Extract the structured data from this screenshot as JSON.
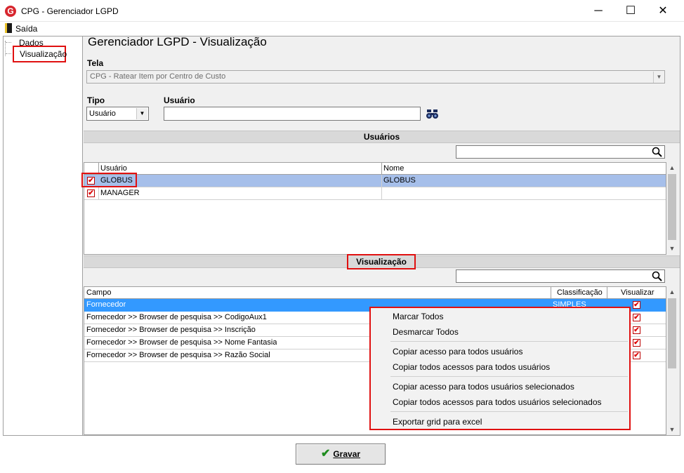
{
  "window": {
    "title": "CPG - Gerenciador LGPD",
    "logo_letter": "G",
    "minimize_glyph": "─",
    "maximize_glyph": "☐",
    "close_glyph": "✕"
  },
  "menu": {
    "exit_label": "Saída"
  },
  "tree": {
    "items": [
      "Dados",
      "Visualização"
    ],
    "selected": "Visualização"
  },
  "page_title": "Gerenciador LGPD - Visualização",
  "tela": {
    "label": "Tela",
    "value": "CPG - Ratear Item por Centro de Custo"
  },
  "tipo": {
    "label": "Tipo",
    "value": "Usuário"
  },
  "usuario": {
    "label": "Usuário",
    "value": ""
  },
  "users_section": {
    "title": "Usuários",
    "search_value": "",
    "columns": [
      "Usuário",
      "Nome"
    ],
    "rows": [
      {
        "checked": true,
        "usuario": "GLOBUS",
        "nome": "GLOBUS",
        "selected": true
      },
      {
        "checked": true,
        "usuario": "MANAGER",
        "nome": "",
        "selected": false
      }
    ]
  },
  "view_section": {
    "title": "Visualização",
    "search_value": "",
    "columns": [
      "Campo",
      "Classificação",
      "Visualizar"
    ],
    "rows": [
      {
        "campo": "Fornecedor",
        "classificacao": "SIMPLES",
        "visualizar": true,
        "selected": true
      },
      {
        "campo": "Fornecedor >> Browser de pesquisa >> CodigoAux1",
        "classificacao": "",
        "visualizar": true,
        "selected": false
      },
      {
        "campo": "Fornecedor >> Browser de pesquisa >> Inscrição",
        "classificacao": "",
        "visualizar": true,
        "selected": false
      },
      {
        "campo": "Fornecedor >> Browser de pesquisa >> Nome Fantasia",
        "classificacao": "",
        "visualizar": true,
        "selected": false
      },
      {
        "campo": "Fornecedor >> Browser de pesquisa >> Razão Social",
        "classificacao": "",
        "visualizar": true,
        "selected": false
      }
    ]
  },
  "context_menu": {
    "items": [
      "Marcar Todos",
      "Desmarcar Todos",
      "Copiar acesso para todos usuários",
      "Copiar todos acessos para todos usuários",
      "Copiar acesso para todos usuários selecionados",
      "Copiar todos acessos para todos usuários selecionados",
      "Exportar grid para excel"
    ]
  },
  "save_button": {
    "label": "Gravar"
  },
  "icons": {
    "check": "✔",
    "checkmark_green": "✔",
    "search": "search-icon",
    "binoculars": "binoculars-icon"
  },
  "colors": {
    "highlight_row": "#a6bfea",
    "selected_row": "#3399ff",
    "red_annotation": "#e01010",
    "check_red": "#dd0000",
    "save_check_green": "#1e8c1e"
  }
}
